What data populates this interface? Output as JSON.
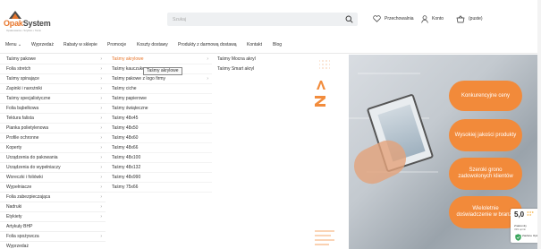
{
  "brand": {
    "name_orange": "Opak",
    "name_dark": "System",
    "tagline": "Opakowania • Szybko • Tanio"
  },
  "search": {
    "placeholder": "Szukaj"
  },
  "header_links": {
    "favorites": "Przechowalnia",
    "account": "Konto",
    "cart": "(puste)"
  },
  "nav": {
    "items": [
      "Menu",
      "Wyprzedaż",
      "Rabaty w sklepie",
      "Promocje",
      "Koszty dostawy",
      "Produkty z darmową dostawą",
      "Kontakt",
      "Blog"
    ]
  },
  "menu_col1": [
    "Taśmy pakowe",
    "Folia stretch",
    "Taśmy spinające",
    "Zapinki i narożniki",
    "Taśmy specjalistyczne",
    "Folia bąbelkowa",
    "Tektura falista",
    "Pianka polietylenowa",
    "Profile ochronne",
    "Koperty",
    "Urządzenia do pakowania",
    "Urządzenia do wypełniaczy",
    "Woreczki i foliówki",
    "Wypełniacze",
    "Folia zabezpieczająca",
    "Nadruki",
    "Etykiety",
    "Artykuły BHP",
    "Folia spożywcza",
    "Wyprzedaż"
  ],
  "menu_col2": [
    "Taśmy akrylowe",
    "Taśmy kauczukowe",
    "Taśmy pakowe z logo firmy",
    "Taśmy ciche",
    "Taśmy papierowe",
    "Taśmy świąteczne",
    "Taśmy 48x45",
    "Taśmy 48x50",
    "Taśmy 48x60",
    "Taśmy 48x66",
    "Taśmy 48x100",
    "Taśmy 48x132",
    "Taśmy 48x990",
    "Taśmy 75x66"
  ],
  "menu_col3": [
    "Taśmy Mocna akryl",
    "Taśmy Smart akryl"
  ],
  "tooltip": "Taśmy akrylowe",
  "hero_pills": [
    "Konkurencyjne ceny",
    "Wysokiej jakości produkty",
    "Szeroki grono zadowolonych klientów",
    "Wieloletnie doświadczenie w branży"
  ],
  "rating": {
    "score": "5,0",
    "label": "Znakomity",
    "count": "339 opinii",
    "badge": "Zaufane Opinie"
  },
  "colors": {
    "accent": "#e8762b",
    "pill": "#f28a3a"
  }
}
